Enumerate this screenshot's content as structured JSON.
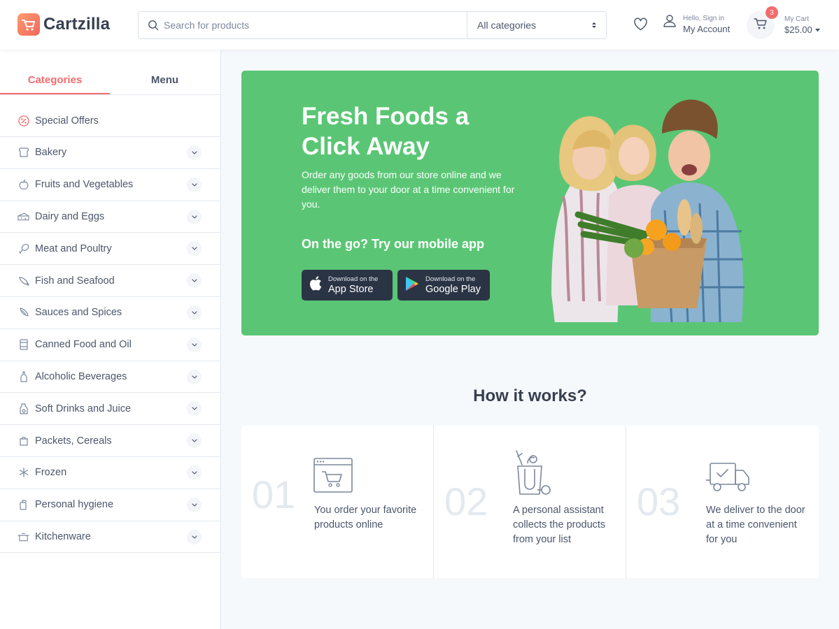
{
  "header": {
    "logo_text": "Cartzilla",
    "search_placeholder": "Search for products",
    "category_select": "All categories",
    "account_small": "Hello, Sign in",
    "account_main": "My Account",
    "cart_badge": "3",
    "cart_small": "My Cart",
    "cart_total": "$25.00"
  },
  "sidebar": {
    "tabs": [
      "Categories",
      "Menu"
    ],
    "active_tab": "Categories",
    "items": [
      {
        "label": "Special Offers",
        "icon": "percent-icon"
      },
      {
        "label": "Bakery",
        "icon": "bread-icon"
      },
      {
        "label": "Fruits and Vegetables",
        "icon": "apple-icon"
      },
      {
        "label": "Dairy and Eggs",
        "icon": "cheese-icon"
      },
      {
        "label": "Meat and Poultry",
        "icon": "drumstick-icon"
      },
      {
        "label": "Fish and Seafood",
        "icon": "fish-icon"
      },
      {
        "label": "Sauces and Spices",
        "icon": "spice-icon"
      },
      {
        "label": "Canned Food and Oil",
        "icon": "can-icon"
      },
      {
        "label": "Alcoholic Beverages",
        "icon": "bottle-icon"
      },
      {
        "label": "Soft Drinks and Juice",
        "icon": "juice-icon"
      },
      {
        "label": "Packets, Cereals",
        "icon": "cereal-icon"
      },
      {
        "label": "Frozen",
        "icon": "snowflake-icon"
      },
      {
        "label": "Personal hygiene",
        "icon": "hygiene-icon"
      },
      {
        "label": "Kitchenware",
        "icon": "pot-icon"
      }
    ]
  },
  "hero": {
    "title": "Fresh Foods a Click Away",
    "subtitle": "Order any goods from our store online and we deliver them to your door at a time convenient for you.",
    "app_heading": "On the go? Try our mobile app",
    "app_store_small": "Download on the",
    "app_store_big": "App Store",
    "google_play_small": "Download on the",
    "google_play_big": "Google Play"
  },
  "how": {
    "title": "How it works?",
    "steps": [
      {
        "num": "01",
        "text": "You order your favorite products online",
        "icon": "online-cart-icon"
      },
      {
        "num": "02",
        "text": "A personal assistant collects the products from your list",
        "icon": "grocery-bag-icon"
      },
      {
        "num": "03",
        "text": "We deliver to the door at a time convenient for you",
        "icon": "delivery-truck-icon"
      }
    ]
  },
  "colors": {
    "accent": "#f26c6d",
    "hero_bg": "#5ac675",
    "dark_button": "#2b3445"
  }
}
